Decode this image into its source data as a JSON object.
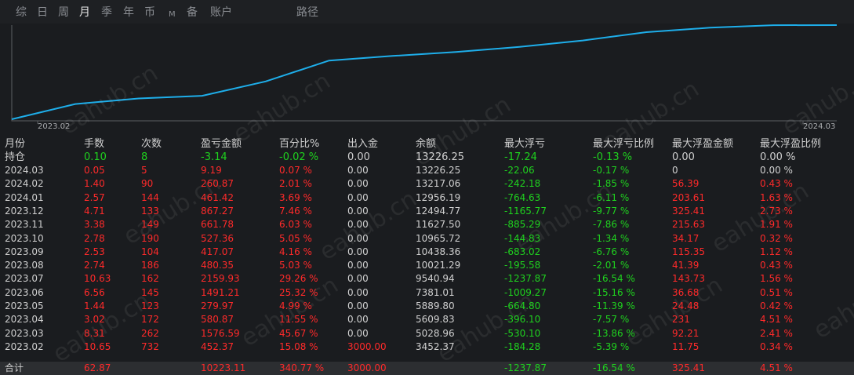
{
  "tabs": [
    "综",
    "日",
    "周",
    "月",
    "季",
    "年",
    "币",
    "M",
    "备",
    "账户",
    "路径"
  ],
  "active_tab": "月",
  "chart": {
    "start_label": "2023.02",
    "end_label": "2024.03",
    "line_color": "#1eaeea",
    "points": [
      {
        "month": "2023.02",
        "balance": 3452.37
      },
      {
        "month": "2023.03",
        "balance": 5028.96
      },
      {
        "month": "2023.04",
        "balance": 5609.83
      },
      {
        "month": "2023.05",
        "balance": 5889.8
      },
      {
        "month": "2023.06",
        "balance": 7381.01
      },
      {
        "month": "2023.07",
        "balance": 9540.94
      },
      {
        "month": "2023.08",
        "balance": 10021.29
      },
      {
        "month": "2023.09",
        "balance": 10438.36
      },
      {
        "month": "2023.10",
        "balance": 10965.72
      },
      {
        "month": "2023.11",
        "balance": 11627.5
      },
      {
        "month": "2023.12",
        "balance": 12494.77
      },
      {
        "month": "2024.01",
        "balance": 12956.19
      },
      {
        "month": "2024.02",
        "balance": 13217.06
      },
      {
        "month": "2024.03",
        "balance": 13226.25
      }
    ]
  },
  "watermark": "eahub.cn",
  "columns": [
    "月份",
    "手数",
    "次数",
    "盈亏金额",
    "百分比%",
    "出入金",
    "余额",
    "最大浮亏",
    "最大浮亏比例",
    "最大浮盈金额",
    "最大浮盈比例"
  ],
  "position_row": [
    "持仓",
    "0.10",
    "8",
    "-3.14",
    "-0.02 %",
    "0.00",
    "13226.25",
    "-17.24",
    "-0.13 %",
    "0.00",
    "0.00 %"
  ],
  "rows": [
    [
      "2024.03",
      "0.05",
      "5",
      "9.19",
      "0.07 %",
      "0.00",
      "13226.25",
      "-22.06",
      "-0.17 %",
      "0",
      "0.00 %"
    ],
    [
      "2024.02",
      "1.40",
      "90",
      "260.87",
      "2.01 %",
      "0.00",
      "13217.06",
      "-242.18",
      "-1.85 %",
      "56.39",
      "0.43 %"
    ],
    [
      "2024.01",
      "2.57",
      "144",
      "461.42",
      "3.69 %",
      "0.00",
      "12956.19",
      "-764.63",
      "-6.11 %",
      "203.61",
      "1.63 %"
    ],
    [
      "2023.12",
      "4.71",
      "133",
      "867.27",
      "7.46 %",
      "0.00",
      "12494.77",
      "-1165.77",
      "-9.77 %",
      "325.41",
      "2.73 %"
    ],
    [
      "2023.11",
      "3.38",
      "149",
      "661.78",
      "6.03 %",
      "0.00",
      "11627.50",
      "-885.29",
      "-7.86 %",
      "215.63",
      "1.91 %"
    ],
    [
      "2023.10",
      "2.78",
      "190",
      "527.36",
      "5.05 %",
      "0.00",
      "10965.72",
      "-144.83",
      "-1.34 %",
      "34.17",
      "0.32 %"
    ],
    [
      "2023.09",
      "2.53",
      "104",
      "417.07",
      "4.16 %",
      "0.00",
      "10438.36",
      "-683.02",
      "-6.76 %",
      "115.35",
      "1.12 %"
    ],
    [
      "2023.08",
      "2.74",
      "186",
      "480.35",
      "5.03 %",
      "0.00",
      "10021.29",
      "-195.58",
      "-2.01 %",
      "41.39",
      "0.43 %"
    ],
    [
      "2023.07",
      "10.63",
      "162",
      "2159.93",
      "29.26 %",
      "0.00",
      "9540.94",
      "-1237.87",
      "-16.54 %",
      "143.73",
      "1.56 %"
    ],
    [
      "2023.06",
      "6.56",
      "145",
      "1491.21",
      "25.32 %",
      "0.00",
      "7381.01",
      "-1009.27",
      "-15.16 %",
      "36.68",
      "0.51 %"
    ],
    [
      "2023.05",
      "1.44",
      "123",
      "279.97",
      "4.99 %",
      "0.00",
      "5889.80",
      "-664.80",
      "-11.39 %",
      "24.48",
      "0.42 %"
    ],
    [
      "2023.04",
      "3.02",
      "172",
      "580.87",
      "11.55 %",
      "0.00",
      "5609.83",
      "-396.10",
      "-7.57 %",
      "231",
      "4.51 %"
    ],
    [
      "2023.03",
      "8.31",
      "262",
      "1576.59",
      "45.67 %",
      "0.00",
      "5028.96",
      "-530.10",
      "-13.86 %",
      "92.21",
      "2.41 %"
    ],
    [
      "2023.02",
      "10.65",
      "732",
      "452.37",
      "15.08 %",
      "3000.00",
      "3452.37",
      "-184.28",
      "-5.39 %",
      "11.75",
      "0.34 %"
    ]
  ],
  "total_row": [
    "合计",
    "62.87",
    "",
    "10223.11",
    "340.77 %",
    "3000.00",
    "",
    "-1237.87",
    "-16.54 %",
    "325.41",
    "4.51 %"
  ],
  "colors": {
    "red": "#ff2a2a",
    "green": "#1fd21f",
    "white": "#d0d0d0"
  }
}
